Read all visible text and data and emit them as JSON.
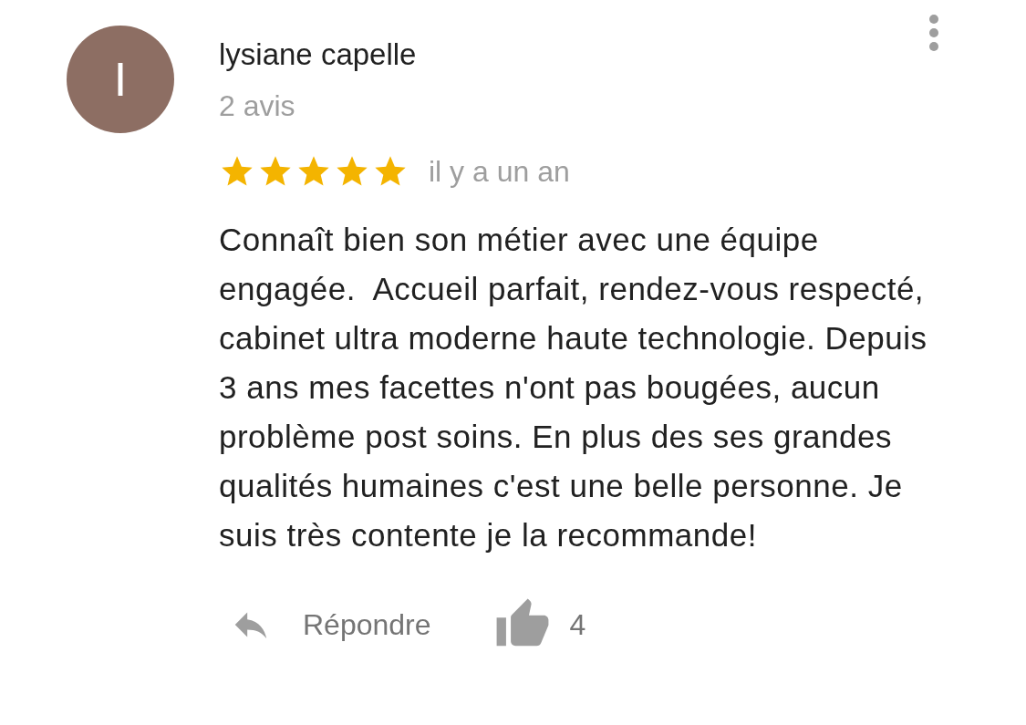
{
  "review": {
    "avatar_letter": "I",
    "author": "lysiane capelle",
    "review_count": "2 avis",
    "stars": 5,
    "time": "il y a un an",
    "text": "Connaît bien son métier avec une équipe engagée.  Accueil parfait, rendez-vous respecté, cabinet ultra moderne haute technologie. Depuis 3 ans mes facettes n'ont pas bougées, aucun problème post soins. En plus des ses grandes qualités humaines c'est une belle personne. Je suis très contente je la recommande!",
    "reply_label": "Répondre",
    "likes": "4"
  }
}
